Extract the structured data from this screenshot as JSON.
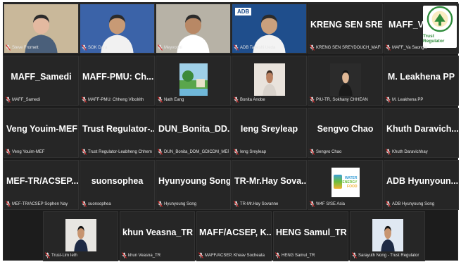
{
  "window": {
    "title": ""
  },
  "participants": [
    {
      "display": "",
      "caption": "Steve Fromett",
      "type": "video",
      "bg": "#c9b89a"
    },
    {
      "display": "",
      "caption": "SOK Dara",
      "type": "video",
      "bg": "#3b63a8"
    },
    {
      "display": "",
      "caption": "Meyvonni",
      "type": "video",
      "bg": "#b7b2a6"
    },
    {
      "display": "",
      "caption": "ADB Takeshi Ueda",
      "type": "video",
      "bg": "#1f4e8c",
      "logo_text": "ADB"
    },
    {
      "display": "KRENG SEN SRE...",
      "caption": "KRENG SEN SREYDOUCH_MAFF",
      "type": "name"
    },
    {
      "display": "MAFF_V...",
      "caption": "MAFF_Va Saongle",
      "type": "name-logo",
      "logo_title": "Trust Regulator"
    },
    {
      "display": "MAFF_Samedi",
      "caption": "MAFF_Samedi",
      "type": "name"
    },
    {
      "display": "MAFF-PMU: Ch...",
      "caption": "MAFF-PMU: Chheng Vibolrith",
      "type": "name"
    },
    {
      "display": "",
      "caption": "Nath Eang",
      "type": "photo-landscape"
    },
    {
      "display": "",
      "caption": "Bonita Anobe",
      "type": "photo-portrait"
    },
    {
      "display": "",
      "caption": "PIU-TR, Sokhany CHHEAN",
      "type": "photo-portrait2"
    },
    {
      "display": "M. Leakhena PP",
      "caption": "M. Leakhena PP",
      "type": "name"
    },
    {
      "display": "Veng Youim-MEF",
      "caption": "Veng Youim-MEF",
      "type": "name"
    },
    {
      "display": "Trust Regulator-...",
      "caption": "Trust Regulator-Leabheng Chhem",
      "type": "name"
    },
    {
      "display": "DUN_Bonita_DD...",
      "caption": "DUN_Bonita_DDM_GDICDM_MEF",
      "type": "name"
    },
    {
      "display": "Ieng Sreyleap",
      "caption": "Ieng Sreyleap",
      "type": "name"
    },
    {
      "display": "Sengvo Chao",
      "caption": "Sengvo Chao",
      "type": "name"
    },
    {
      "display": "Khuth Daravich...",
      "caption": "Khuth Daravichhay",
      "type": "name"
    },
    {
      "display": "MEF-TR/ACSEP...",
      "caption": "MEF-TR/ACSEP Sophen Nay",
      "type": "name"
    },
    {
      "display": "suonsophea",
      "caption": "suonsophea",
      "type": "name"
    },
    {
      "display": "Hyunyoung Song",
      "caption": "Hyunyoung Song",
      "type": "name"
    },
    {
      "display": "TR-Mr.Hay Sova...",
      "caption": "TR-Mr.Hay Sovanne",
      "type": "name"
    },
    {
      "display": "",
      "caption": "W4F S/SE Asia",
      "type": "w4f-logo",
      "logo_lines": [
        "WATER",
        "ENERGY",
        "FOOD"
      ]
    },
    {
      "display": "ADB Hyunyoun...",
      "caption": "ADB Hyunyoung Song",
      "type": "name"
    },
    {
      "display": "",
      "caption": "Trust-Lim Ieth",
      "type": "photo-suit"
    },
    {
      "display": "khun Veasna_TR",
      "caption": "khun Veasna_TR",
      "type": "name"
    },
    {
      "display": "MAFF/ACSEP, K...",
      "caption": "MAFF/ACSEP, Kheav Socheata",
      "type": "name"
    },
    {
      "display": "HENG Samul_TR",
      "caption": "HENG Samul_TR",
      "type": "name"
    },
    {
      "display": "",
      "caption": "Sarayuth Nong - Trust Regulator",
      "type": "photo-suit2"
    }
  ],
  "colors": {
    "mic_muted": "#e02424",
    "tile_bg": "#262626",
    "stage_bg": "#1c1c1c"
  }
}
